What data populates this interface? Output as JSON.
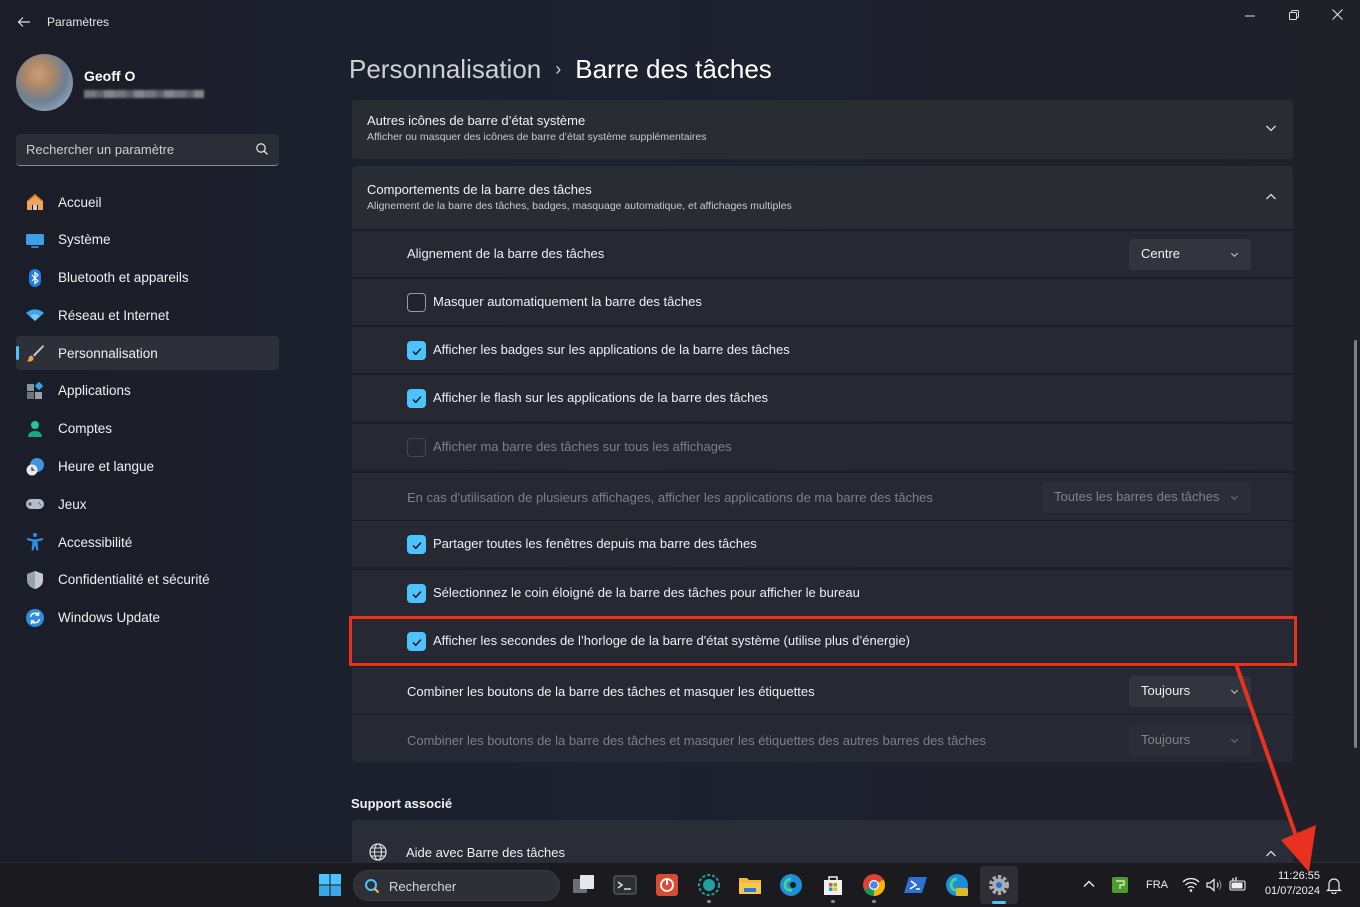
{
  "window": {
    "app_title": "Paramètres",
    "controls": {
      "minimize": "—",
      "maximize": "❐",
      "close": "✕"
    }
  },
  "profile": {
    "name": "Geoff O",
    "email": "(masqué)"
  },
  "search": {
    "placeholder": "Rechercher un paramètre",
    "value": ""
  },
  "sidebar": {
    "items": [
      {
        "label": "Accueil",
        "icon": "home-icon",
        "active": false
      },
      {
        "label": "Système",
        "icon": "system-icon",
        "active": false
      },
      {
        "label": "Bluetooth et appareils",
        "icon": "bluetooth-icon",
        "active": false
      },
      {
        "label": "Réseau et Internet",
        "icon": "wifi-icon",
        "active": false
      },
      {
        "label": "Personnalisation",
        "icon": "brush-icon",
        "active": true
      },
      {
        "label": "Applications",
        "icon": "apps-icon",
        "active": false
      },
      {
        "label": "Comptes",
        "icon": "account-icon",
        "active": false
      },
      {
        "label": "Heure et langue",
        "icon": "time-language-icon",
        "active": false
      },
      {
        "label": "Jeux",
        "icon": "gamepad-icon",
        "active": false
      },
      {
        "label": "Accessibilité",
        "icon": "accessibility-icon",
        "active": false
      },
      {
        "label": "Confidentialité et sécurité",
        "icon": "shield-icon",
        "active": false
      },
      {
        "label": "Windows Update",
        "icon": "update-icon",
        "active": false
      }
    ]
  },
  "breadcrumb": {
    "parent": "Personnalisation",
    "separator": "›",
    "current": "Barre des tâches"
  },
  "sections": {
    "tray_icons": {
      "title": "Autres icônes de barre d’état système",
      "subtitle": "Afficher ou masquer des icônes de barre d’état système supplémentaires",
      "expanded": false
    },
    "behaviors": {
      "title": "Comportements de la barre des tâches",
      "subtitle": "Alignement de la barre des tâches, badges, masquage automatique, et affichages multiples",
      "expanded": true,
      "alignment": {
        "label": "Alignement de la barre des tâches",
        "value": "Centre"
      },
      "checkboxes": [
        {
          "label": "Masquer automatiquement la barre des tâches",
          "checked": false,
          "enabled": true
        },
        {
          "label": "Afficher les badges sur les applications de la barre des tâches",
          "checked": true,
          "enabled": true
        },
        {
          "label": "Afficher le flash sur les applications de la barre des tâches",
          "checked": true,
          "enabled": true
        },
        {
          "label": "Afficher ma barre des tâches sur tous les affichages",
          "checked": false,
          "enabled": false
        }
      ],
      "multi_display": {
        "label": "En cas d'utilisation de plusieurs affichages, afficher les applications de ma barre des tâches",
        "value": "Toutes les barres des tâches",
        "enabled": false
      },
      "checkboxes2": [
        {
          "label": "Partager toutes les fenêtres depuis ma barre des tâches",
          "checked": true,
          "enabled": true
        },
        {
          "label": "Sélectionnez le coin éloigné de la barre des tâches pour afficher le bureau",
          "checked": true,
          "enabled": true
        },
        {
          "label": "Afficher les secondes de l’horloge de la barre d'état système (utilise plus d’énergie)",
          "checked": true,
          "enabled": true,
          "highlighted": true
        }
      ],
      "combine": {
        "label": "Combiner les boutons de la barre des tâches et masquer les étiquettes",
        "value": "Toujours",
        "enabled": true
      },
      "combine_other": {
        "label": "Combiner les boutons de la barre des tâches et masquer les étiquettes des autres barres des tâches",
        "value": "Toujours",
        "enabled": false
      }
    }
  },
  "support": {
    "title": "Support associé",
    "help_label": "Aide avec Barre des tâches"
  },
  "annotation": {
    "highlight_color": "#e8321f"
  },
  "taskbar": {
    "search_label": "Rechercher",
    "apps": [
      "start-icon",
      "task-view-icon",
      "terminal-icon",
      "power-app-icon",
      "copilot-icon",
      "file-explorer-icon",
      "edge-icon",
      "store-icon",
      "chrome-icon",
      "powershell-icon",
      "edge-canary-icon",
      "settings-icon"
    ],
    "tray": {
      "language": "FRA",
      "time": "11:26:55",
      "date": "01/07/2024"
    }
  },
  "colors": {
    "accent": "#4cc2ff",
    "background": "#1c1e26",
    "card": "#2a2c34"
  }
}
